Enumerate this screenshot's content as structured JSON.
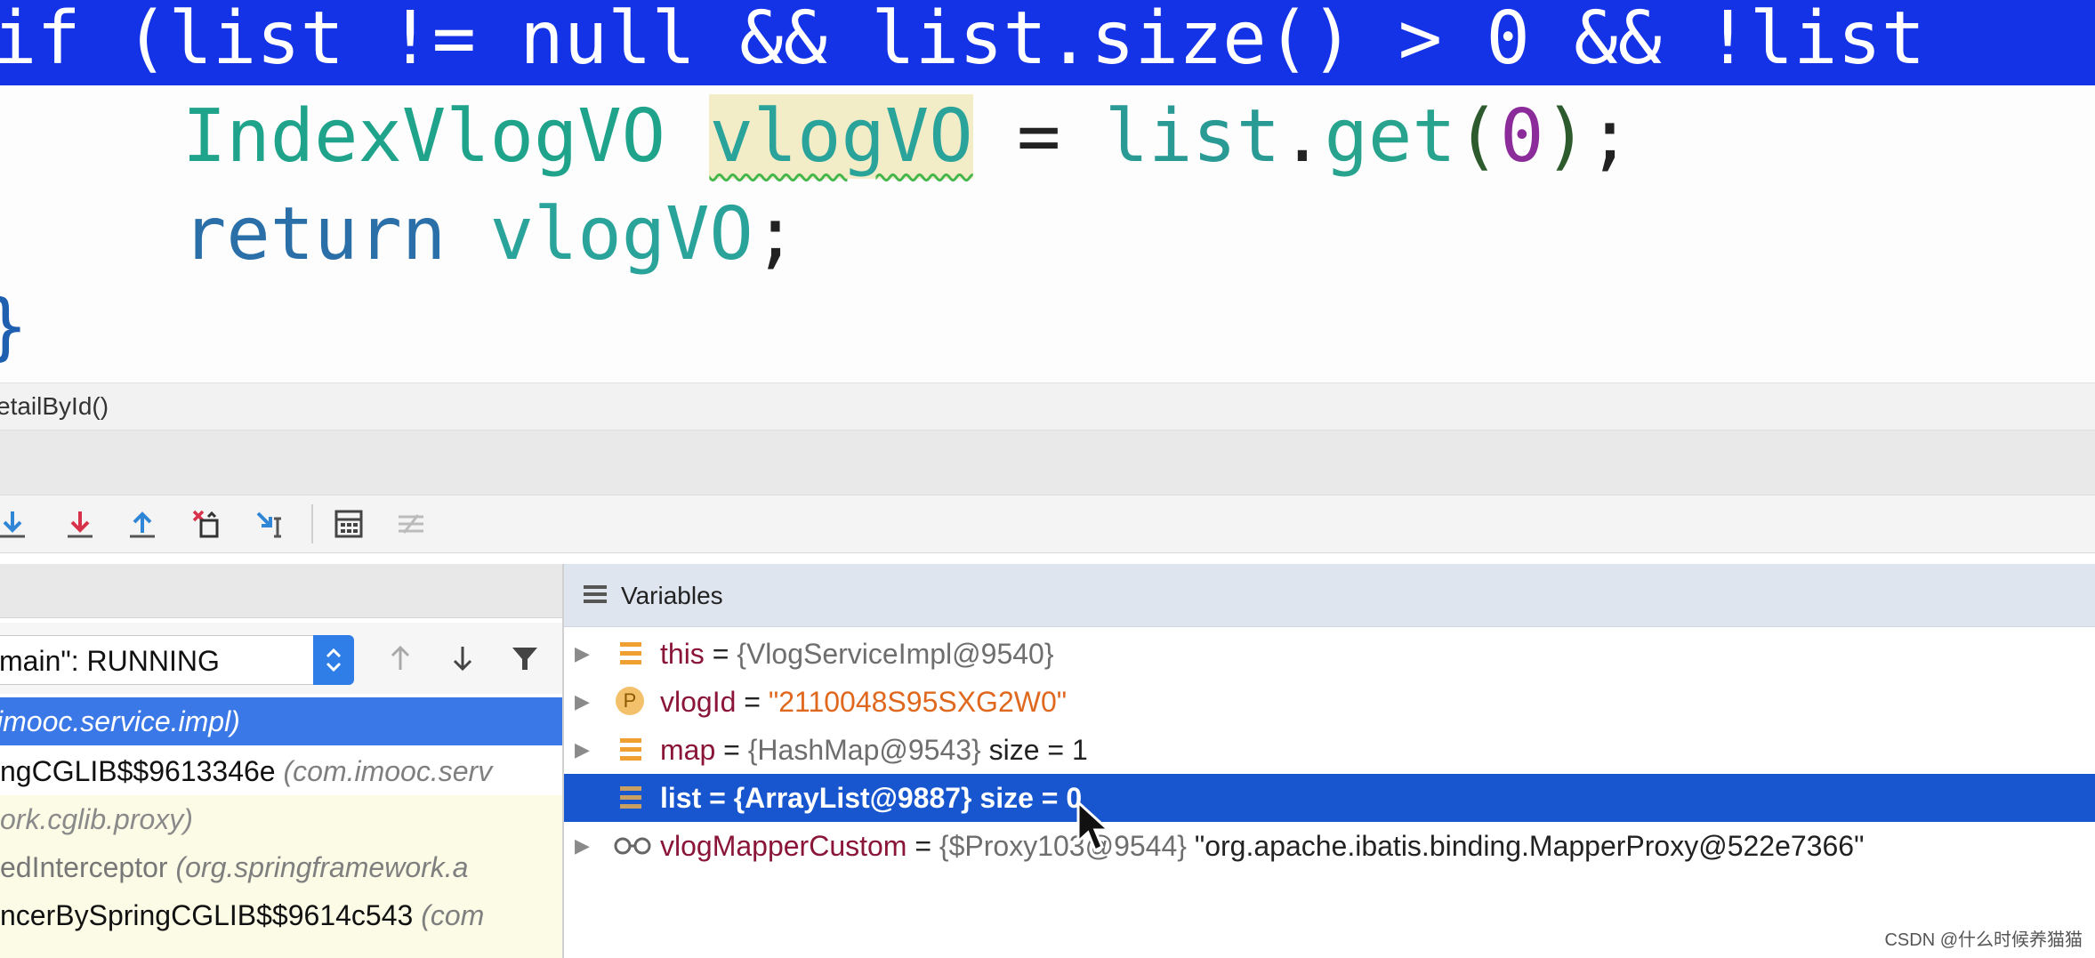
{
  "editor": {
    "highlight_line": "if (list != null && list.size() > 0 && !list",
    "line1": {
      "type": "IndexVlogVO",
      "var": "vlogVO",
      "eq": "=",
      "obj": "list",
      "dot": ".",
      "method": "get",
      "open": "(",
      "arg": "0",
      "close": ")",
      "semi": ";"
    },
    "line2": {
      "keyword": "return",
      "var": "vlogVO",
      "semi": ";"
    },
    "brace": "}"
  },
  "breadcrumb": "etailById()",
  "frames": {
    "thread_label": "main\": RUNNING",
    "items": [
      {
        "text": "imooc.service.impl)"
      },
      {
        "main": "ngCGLIB$$9613346e ",
        "pkg": "(com.imooc.serv"
      },
      {
        "main": "ork.cglib.proxy)"
      },
      {
        "main": "edInterceptor ",
        "pkg": "(org.springframework.a"
      },
      {
        "main": "ncerBySpringCGLIB$$9614c543 ",
        "pkg": "(com"
      },
      {
        "main": ","
      }
    ]
  },
  "variables": {
    "title": "Variables",
    "rows": [
      {
        "name": "this",
        "eq": " = ",
        "value": "{VlogServiceImpl@9540}",
        "extra": ""
      },
      {
        "name": "vlogId",
        "eq": " = ",
        "value": "\"2110048S95SXG2W0\"",
        "extra": ""
      },
      {
        "name": "map",
        "eq": " = ",
        "value": "{HashMap@9543}",
        "extra": "  size = 1"
      },
      {
        "name": "list",
        "eq": " = ",
        "value": "{ArrayList@9887}",
        "extra": "  size = 0"
      },
      {
        "name": "vlogMapperCustom",
        "eq": " = ",
        "value": "{$Proxy103@9544}",
        "extra": " \"org.apache.ibatis.binding.MapperProxy@522e7366\""
      }
    ],
    "param_badge": "P"
  },
  "watermark": "CSDN @什么时候养猫猫"
}
